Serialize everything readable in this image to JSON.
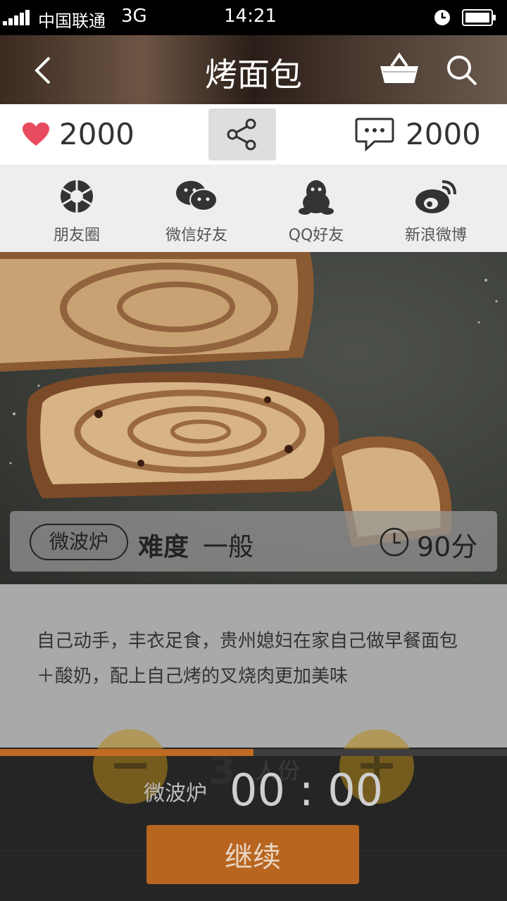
{
  "status_bar": {
    "carrier": "中国联通",
    "network": "3G",
    "time": "14:21"
  },
  "header": {
    "title": "烤面包"
  },
  "stats": {
    "likes": "2000",
    "comments": "2000"
  },
  "share_targets": [
    {
      "label": "朋友圈",
      "icon": "aperture-icon"
    },
    {
      "label": "微信好友",
      "icon": "wechat-icon"
    },
    {
      "label": "QQ好友",
      "icon": "qq-penguin-icon"
    },
    {
      "label": "新浪微博",
      "icon": "weibo-icon"
    }
  ],
  "recipe": {
    "tag": "微波炉",
    "difficulty_label": "难度",
    "difficulty_value": "一般",
    "time": "90分",
    "description": "自己动手，丰衣足食，贵州媳妇在家自己做早餐面包＋酸奶，配上自己烤的叉烧肉更加美味"
  },
  "servings": {
    "count": "3",
    "unit": "人份"
  },
  "timer": {
    "label": "微波炉",
    "value": "00 : 00",
    "progress": 0.5
  },
  "actions": {
    "continue_label": "继续"
  },
  "colors": {
    "accent": "#b8651f",
    "heart": "#e84a5f",
    "header_bg": "#4a3a30"
  }
}
